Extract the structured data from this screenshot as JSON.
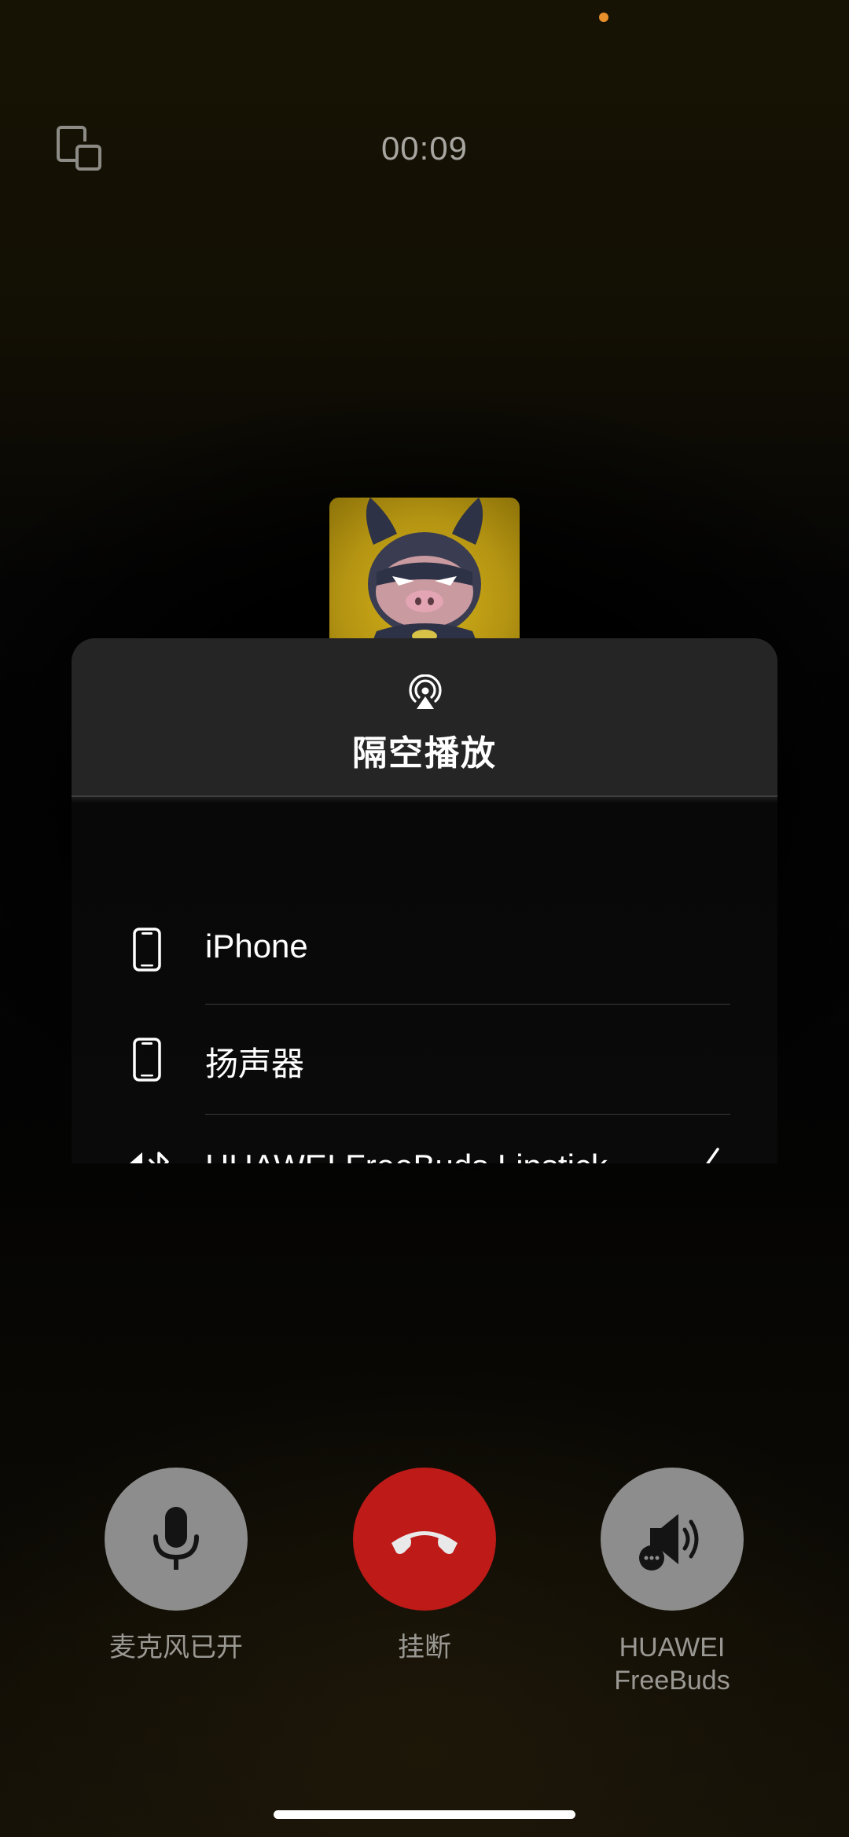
{
  "status": {
    "recording_indicator_color": "#e8902b"
  },
  "call": {
    "timer": "00:09"
  },
  "sheet": {
    "title": "隔空播放",
    "title_icon": "airplay-icon",
    "options": [
      {
        "label": "iPhone",
        "icon": "iphone-icon",
        "selected": false
      },
      {
        "label": "扬声器",
        "icon": "iphone-icon",
        "selected": false
      },
      {
        "label": "HUAWEI FreeBuds Lipstick",
        "icon": "speaker-bluetooth-icon",
        "selected": true
      }
    ]
  },
  "controls": {
    "mic": {
      "label": "麦克风已开",
      "icon": "microphone-icon"
    },
    "end": {
      "label": "挂断",
      "icon": "phone-hangup-icon",
      "color": "#bd1a18"
    },
    "audio": {
      "label_line1": "HUAWEI",
      "label_line2": "FreeBuds",
      "icon": "speaker-options-icon"
    }
  }
}
